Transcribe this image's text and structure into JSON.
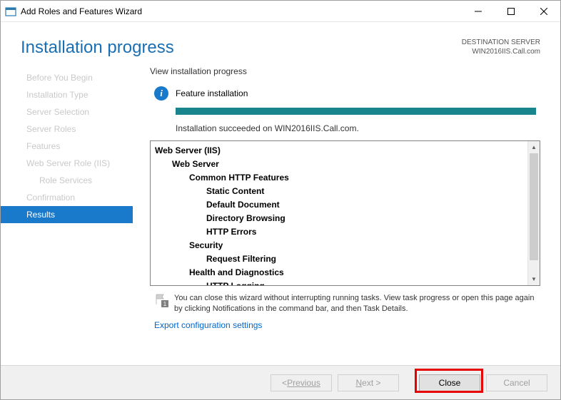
{
  "titlebar": {
    "title": "Add Roles and Features Wizard"
  },
  "header": {
    "title": "Installation progress",
    "dest_label": "DESTINATION SERVER",
    "dest_server": "WIN2016IIS.Call.com"
  },
  "sidebar": {
    "items": [
      {
        "label": "Before You Begin"
      },
      {
        "label": "Installation Type"
      },
      {
        "label": "Server Selection"
      },
      {
        "label": "Server Roles"
      },
      {
        "label": "Features"
      },
      {
        "label": "Web Server Role (IIS)"
      },
      {
        "label": "Role Services"
      },
      {
        "label": "Confirmation"
      },
      {
        "label": "Results"
      }
    ]
  },
  "main": {
    "subtitle": "View installation progress",
    "status": "Feature installation",
    "succeeded": "Installation succeeded on WIN2016IIS.Call.com.",
    "tree": [
      {
        "level": 0,
        "text": "Web Server (IIS)"
      },
      {
        "level": 1,
        "text": "Web Server"
      },
      {
        "level": 2,
        "text": "Common HTTP Features"
      },
      {
        "level": 3,
        "text": "Static Content"
      },
      {
        "level": 3,
        "text": "Default Document"
      },
      {
        "level": 3,
        "text": "Directory Browsing"
      },
      {
        "level": 3,
        "text": "HTTP Errors"
      },
      {
        "level": 2,
        "text": "Security"
      },
      {
        "level": 3,
        "text": "Request Filtering"
      },
      {
        "level": 2,
        "text": "Health and Diagnostics"
      },
      {
        "level": 3,
        "text": "HTTP Logging"
      }
    ],
    "hint": "You can close this wizard without interrupting running tasks. View task progress or open this page again by clicking Notifications in the command bar, and then Task Details.",
    "flag_badge": "1",
    "export": "Export configuration settings"
  },
  "footer": {
    "previous": "Previous",
    "next": "Next >",
    "close": "Close",
    "cancel": "Cancel"
  }
}
